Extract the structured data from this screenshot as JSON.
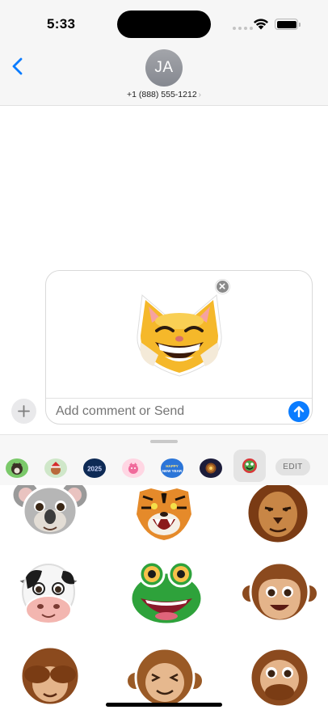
{
  "status": {
    "time": "5:33"
  },
  "header": {
    "avatar_initials": "JA",
    "contact": "+1 (888) 555-1212",
    "contact_chevron": "›"
  },
  "composer": {
    "placeholder": "Add comment or Send",
    "preview_sticker": "smiling-cat-sticker"
  },
  "tray": {
    "edit_label": "EDIT",
    "tabs": [
      {
        "icon": "dog-sticker-pack",
        "active": false
      },
      {
        "icon": "cat-santa-sticker-pack",
        "active": false
      },
      {
        "icon": "2025-sticker-pack",
        "active": false
      },
      {
        "icon": "pink-dragon-sticker-pack",
        "active": false
      },
      {
        "icon": "happy-new-year-sticker-pack",
        "active": false
      },
      {
        "icon": "sparkle-badge-sticker-pack",
        "active": false
      },
      {
        "icon": "animal-faces-sticker-pack",
        "active": true
      }
    ],
    "stickers": [
      "koala-sticker",
      "tiger-sticker",
      "lion-sticker",
      "cow-sticker",
      "frog-sticker",
      "monkey-sticker",
      "see-no-evil-monkey-sticker",
      "laughing-monkey-sticker",
      "speak-no-evil-monkey-sticker"
    ]
  },
  "colors": {
    "accent": "#0a7cff",
    "header_bg": "#f6f6f6",
    "tray_bg": "#f7f7f7"
  }
}
